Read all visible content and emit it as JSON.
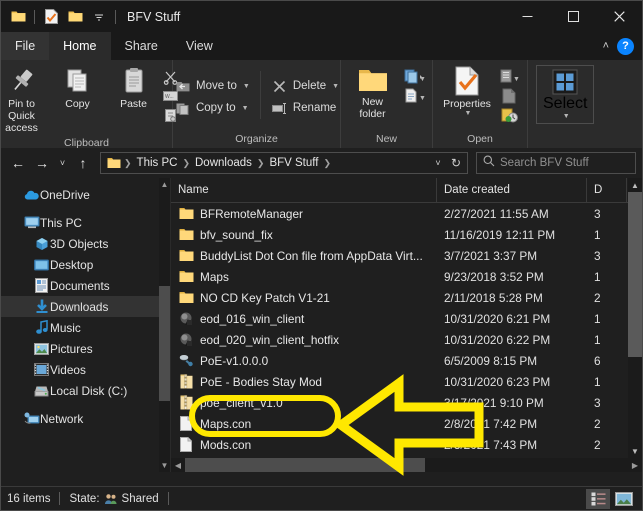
{
  "window": {
    "title": "BFV Stuff",
    "quick_access": [
      "folder-icon",
      "properties-icon",
      "new-folder-icon",
      "customize-dropdown-icon"
    ],
    "minimize": "–",
    "maximize": "☐",
    "close": "✕"
  },
  "tabs": [
    {
      "label": "File",
      "style": "file"
    },
    {
      "label": "Home",
      "style": "active"
    },
    {
      "label": "Share",
      "style": ""
    },
    {
      "label": "View",
      "style": ""
    }
  ],
  "tabbar_right": {
    "collapse": "˄",
    "help": "?"
  },
  "ribbon": {
    "groups": [
      {
        "name": "Clipboard",
        "label": "Clipboard",
        "big_buttons": [
          {
            "name": "pin-to-quick-access",
            "label": "Pin to Quick\naccess",
            "icon": "pin-icon"
          },
          {
            "name": "copy",
            "label": "Copy",
            "icon": "copy-icon"
          },
          {
            "name": "paste",
            "label": "Paste",
            "icon": "paste-icon"
          }
        ],
        "small_icons": [
          "cut-icon",
          "copy-path-icon",
          "paste-shortcut-icon"
        ]
      },
      {
        "name": "Organize",
        "label": "Organize",
        "small_buttons": [
          {
            "label": "Move to",
            "icon": "move-to-icon",
            "dropdown": true
          },
          {
            "label": "Copy to",
            "icon": "copy-to-icon",
            "dropdown": true
          },
          {
            "label": "Delete",
            "icon": "delete-icon",
            "dropdown": true
          },
          {
            "label": "Rename",
            "icon": "rename-icon",
            "dropdown": false
          }
        ]
      },
      {
        "name": "New",
        "label": "New",
        "big_buttons": [
          {
            "name": "new-folder",
            "label": "New\nfolder",
            "icon": "new-folder-icon"
          }
        ],
        "small_icons": [
          "new-item-icon",
          "easy-access-icon"
        ]
      },
      {
        "name": "Open",
        "label": "Open",
        "big_buttons": [
          {
            "name": "properties",
            "label": "Properties",
            "icon": "properties-icon",
            "dropdown": true
          }
        ],
        "small_icons": [
          "open-icon",
          "edit-icon",
          "history-icon"
        ]
      },
      {
        "name": "Select",
        "label": "",
        "big_buttons": [
          {
            "name": "select",
            "label": "Select",
            "icon": "select-icon",
            "dropdown": true
          }
        ]
      }
    ]
  },
  "address": {
    "back": "←",
    "forward": "→",
    "recent": "˅",
    "up": "↑",
    "crumbs": [
      "This PC",
      "Downloads",
      "BFV Stuff"
    ],
    "dropdown": "˅",
    "refresh": "↻",
    "search_placeholder": "Search BFV Stuff",
    "search_value": ""
  },
  "sidebar": {
    "items": [
      {
        "label": "OneDrive",
        "icon": "onedrive-icon",
        "indent": 0,
        "selected": false
      },
      {
        "label": "This PC",
        "icon": "this-pc-icon",
        "indent": 0,
        "selected": false
      },
      {
        "label": "3D Objects",
        "icon": "3d-objects-icon",
        "indent": 1,
        "selected": false
      },
      {
        "label": "Desktop",
        "icon": "desktop-icon",
        "indent": 1,
        "selected": false
      },
      {
        "label": "Documents",
        "icon": "documents-icon",
        "indent": 1,
        "selected": false
      },
      {
        "label": "Downloads",
        "icon": "downloads-icon",
        "indent": 1,
        "selected": true
      },
      {
        "label": "Music",
        "icon": "music-icon",
        "indent": 1,
        "selected": false
      },
      {
        "label": "Pictures",
        "icon": "pictures-icon",
        "indent": 1,
        "selected": false
      },
      {
        "label": "Videos",
        "icon": "videos-icon",
        "indent": 1,
        "selected": false
      },
      {
        "label": "Local Disk (C:)",
        "icon": "local-disk-icon",
        "indent": 1,
        "selected": false
      },
      {
        "label": "Network",
        "icon": "network-icon",
        "indent": 0,
        "selected": false
      }
    ]
  },
  "filelist": {
    "columns": [
      "Name",
      "Date created",
      "D"
    ],
    "rows": [
      {
        "name": "BFRemoteManager",
        "date": "2/27/2021 11:55 AM",
        "size": "3",
        "icon": "folder-icon"
      },
      {
        "name": "bfv_sound_fix",
        "date": "11/16/2019 12:11 PM",
        "size": "1",
        "icon": "folder-icon"
      },
      {
        "name": "BuddyList Dot Con file from AppData Virt...",
        "date": "3/7/2021 3:37 PM",
        "size": "3",
        "icon": "folder-icon"
      },
      {
        "name": "Maps",
        "date": "9/23/2018 3:52 PM",
        "size": "1",
        "icon": "folder-icon"
      },
      {
        "name": "NO CD Key Patch V1-21",
        "date": "2/11/2018 5:28 PM",
        "size": "2",
        "icon": "folder-icon"
      },
      {
        "name": "eod_016_win_client",
        "date": "10/31/2020 6:21 PM",
        "size": "1",
        "icon": "exe-icon"
      },
      {
        "name": "eod_020_win_client_hotfix",
        "date": "10/31/2020 6:22 PM",
        "size": "1",
        "icon": "exe-icon"
      },
      {
        "name": "PoE-v1.0.0.0",
        "date": "6/5/2009 8:15 PM",
        "size": "6",
        "icon": "installer-icon"
      },
      {
        "name": "PoE - Bodies Stay Mod",
        "date": "10/31/2020 6:23 PM",
        "size": "1",
        "icon": "zip-icon"
      },
      {
        "name": "poe_client_v1.0",
        "date": "3/17/2021 9:10 PM",
        "size": "3",
        "icon": "zip-icon"
      },
      {
        "name": "Maps.con",
        "date": "2/8/2021 7:42 PM",
        "size": "2",
        "icon": "con-file-icon"
      },
      {
        "name": "Mods.con",
        "date": "2/3/2021 7:43 PM",
        "size": "2",
        "icon": "con-file-icon"
      }
    ]
  },
  "statusbar": {
    "item_count": "16 items",
    "state_label": "State:",
    "state_value": "Shared",
    "view_details": "details-view-icon",
    "view_large": "large-icons-view-icon"
  },
  "annotation": {
    "color": "#ffe800",
    "shape": "left-arrow",
    "highlighted_item": "poe_client_v1.0"
  }
}
